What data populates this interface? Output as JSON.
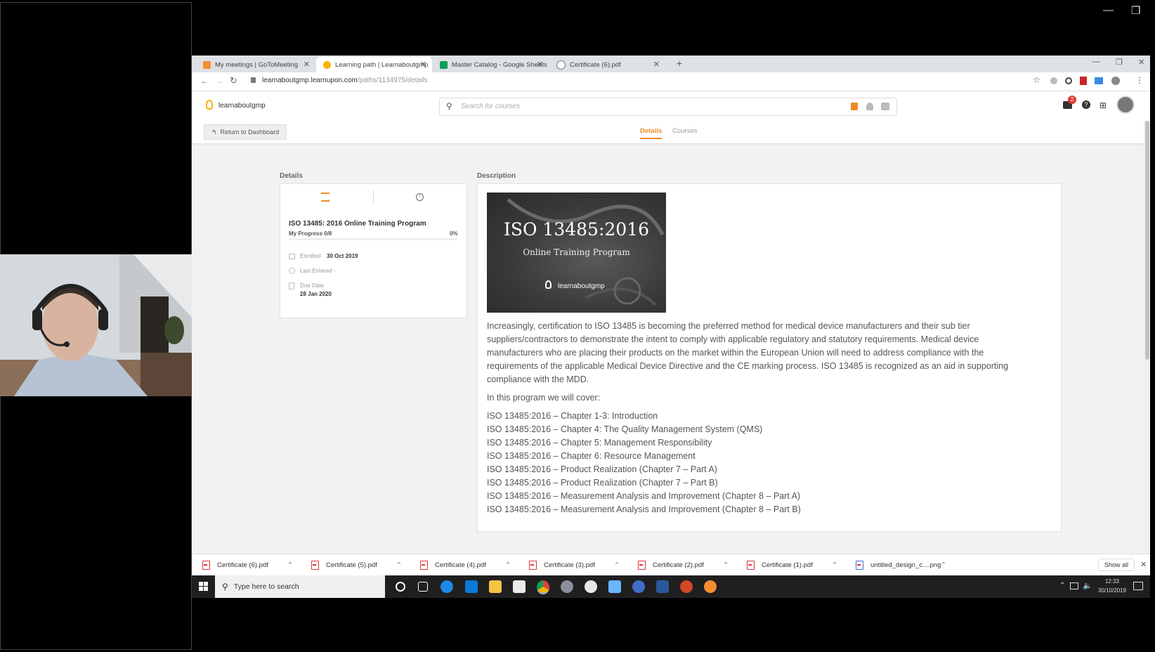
{
  "meeting": {
    "minimize_glyph": "—",
    "restore_glyph": "❐"
  },
  "browser": {
    "tabs": [
      {
        "label": "My meetings | GoToMeeting",
        "fav_color": "#f68d2e"
      },
      {
        "label": "Learning path | Learnaboutgmp",
        "fav_color": "#f5b400"
      },
      {
        "label": "Master Catalog - Google Sheets",
        "fav_color": "#0f9d58"
      },
      {
        "label": "Certificate (6).pdf",
        "fav_color": "#777777"
      }
    ],
    "new_tab": "+",
    "url_host": "learnaboutgmp.learnupon.com",
    "url_path": "/paths/1134975/details",
    "window_min": "—",
    "window_max": "❐",
    "window_close": "✕"
  },
  "app": {
    "brand": "learnaboutgmp",
    "search_placeholder": "Search for courses",
    "notification_count": "2",
    "return_button": "Return to Dashboard",
    "tabs": {
      "details": "Details",
      "courses": "Courses"
    },
    "accent": "#f08a24"
  },
  "details": {
    "section_title": "Details",
    "course_title": "ISO 13485: 2016 Online Training Program",
    "progress_label": "My Progress 0/8",
    "progress_percent": "0%",
    "progress_value": 0,
    "enrolled_label": "Enrolled",
    "enrolled_value": "30 Oct 2019",
    "last_entered_label": "Last Entered -",
    "due_label": "Due Date",
    "due_value": "28 Jan 2020"
  },
  "description": {
    "section_title": "Description",
    "banner_title": "ISO 13485:2016",
    "banner_subtitle": "Online Training Program",
    "banner_brand": "learnaboutgmp",
    "paragraph": "Increasingly, certification to ISO 13485 is becoming the preferred method for medical device manufacturers and their sub tier suppliers/contractors to demonstrate the intent to comply with applicable regulatory and statutory requirements. Medical device manufacturers who are placing their products on the market within the European Union will need to address compliance with the requirements of the applicable Medical Device Directive and the CE marking process. ISO 13485 is recognized as an aid in supporting compliance with the MDD.",
    "cover_intro": "In this program we will cover:",
    "cover_items": [
      "ISO 13485:2016 – Chapter 1-3: Introduction",
      "ISO 13485:2016 – Chapter 4: The Quality Management System (QMS)",
      "ISO 13485:2016 – Chapter 5: Management Responsibility",
      "ISO 13485:2016 – Chapter 6: Resource Management",
      "ISO 13485:2016 – Product Realization (Chapter 7 – Part A)",
      "ISO 13485:2016 – Product Realization (Chapter 7 – Part B)",
      "ISO 13485:2016 – Measurement Analysis and Improvement (Chapter 8 – Part A)",
      "ISO 13485:2016 – Measurement Analysis and Improvement (Chapter 8 – Part B)"
    ]
  },
  "downloads": {
    "items": [
      "Certificate (6).pdf",
      "Certificate (5).pdf",
      "Certificate (4).pdf",
      "Certificate (3).pdf",
      "Certificate (2).pdf",
      "Certificate (1).pdf",
      "untitled_design_c....png"
    ],
    "show_all": "Show all",
    "close": "✕"
  },
  "taskbar": {
    "search_placeholder": "Type here to search",
    "time": "12:33",
    "date": "30/10/2019"
  }
}
